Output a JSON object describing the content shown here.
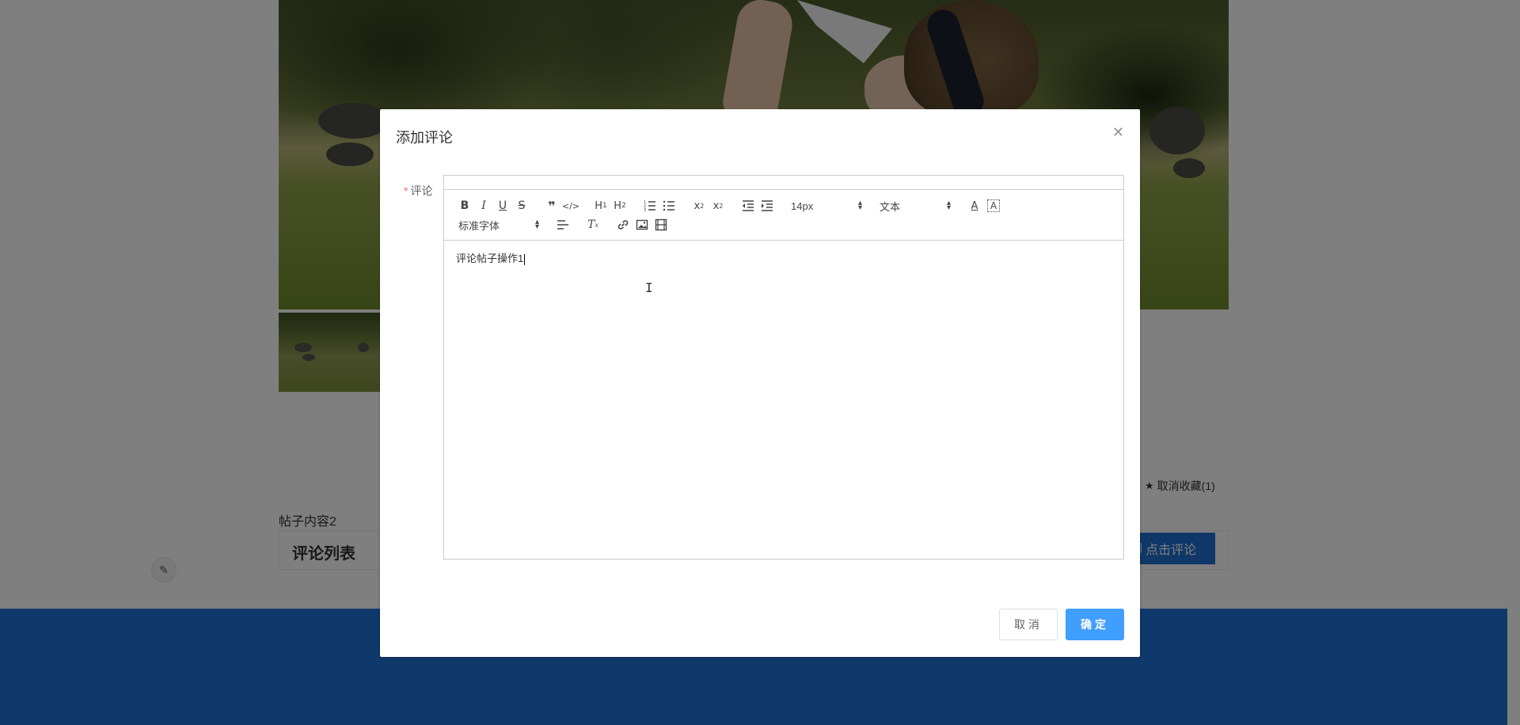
{
  "page": {
    "favorite_label": "取消收藏(1)",
    "post_content_label": "帖子内容2",
    "comment_list_title": "评论列表",
    "comment_button_label": "点击评论"
  },
  "dialog": {
    "title": "添加评论",
    "field_label": "评论",
    "required_mark": "*",
    "editor_text": "评论帖子操作1",
    "cancel_label": "取消",
    "confirm_label": "确定"
  },
  "toolbar": {
    "font_size": "14px",
    "header_select": "文本",
    "font_family": "标准字体",
    "icons": [
      "bold-icon",
      "italic-icon",
      "underline-icon",
      "strike-icon",
      "blockquote-icon",
      "code-block-icon",
      "h1-icon",
      "h2-icon",
      "ordered-list-icon",
      "bullet-list-icon",
      "subscript-icon",
      "superscript-icon",
      "outdent-icon",
      "indent-icon",
      "font-color-icon",
      "background-color-icon",
      "align-icon",
      "clear-format-icon",
      "link-icon",
      "image-icon",
      "video-icon"
    ]
  },
  "colors": {
    "primary": "#409eff",
    "footer": "#1f72d6",
    "comment_button": "#1f6fd0",
    "required": "#f56c6c"
  }
}
